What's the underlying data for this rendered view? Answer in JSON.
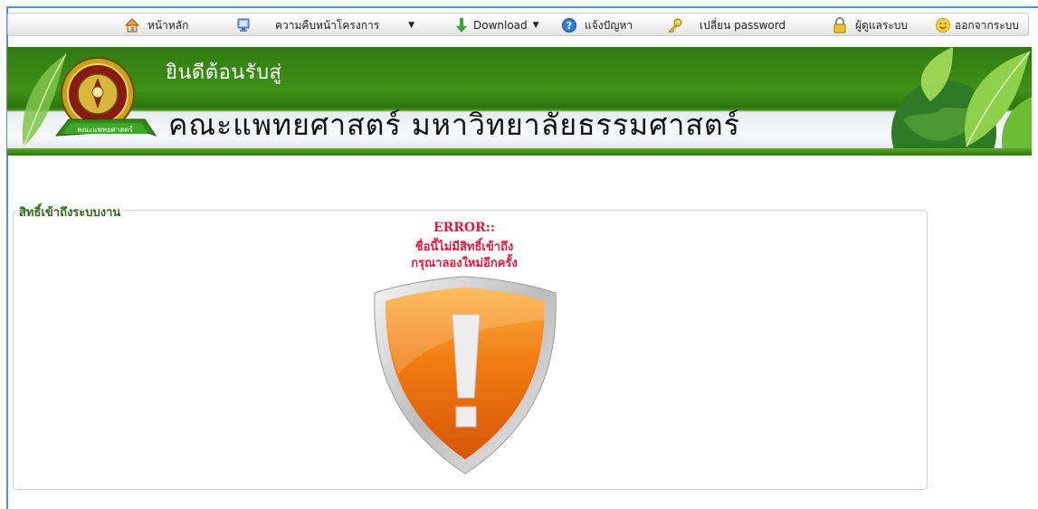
{
  "menu": {
    "home": "หน้าหลัก",
    "progress": "ความคืบหน้าโครงการ",
    "download": "Download",
    "report": "แจ้งปัญหา",
    "change_password": "เปลี่ยน password",
    "admin": "ผู้ดูแลระบบ",
    "logout": "ออกจากระบบ"
  },
  "icons": {
    "home": "home-icon",
    "progress": "monitor-icon",
    "download": "download-arrow-icon",
    "report": "help-icon",
    "change_password": "key-icon",
    "admin": "lock-icon",
    "logout": "smiley-icon"
  },
  "header": {
    "welcome": "ยินดีต้อนรับสู่",
    "faculty": "คณะแพทยศาสตร์ มหาวิทยาลัยธรรมศาสตร์",
    "logo_text": "คณะแพทยศาสตร์"
  },
  "panel": {
    "legend": "สิทธิ์เข้าถึงระบบงาน",
    "error_title": "ERROR::",
    "error_line1": "ชื่อนี้ไม่มีสิทธิ์เข้าถึง",
    "error_line2": "กรุณาลองใหม่อีกครั้ง"
  },
  "colors": {
    "header_green": "#2f7a10",
    "error_red": "#e3183b",
    "legend_green": "#2e6b1a",
    "shield_orange": "#f07a10"
  }
}
